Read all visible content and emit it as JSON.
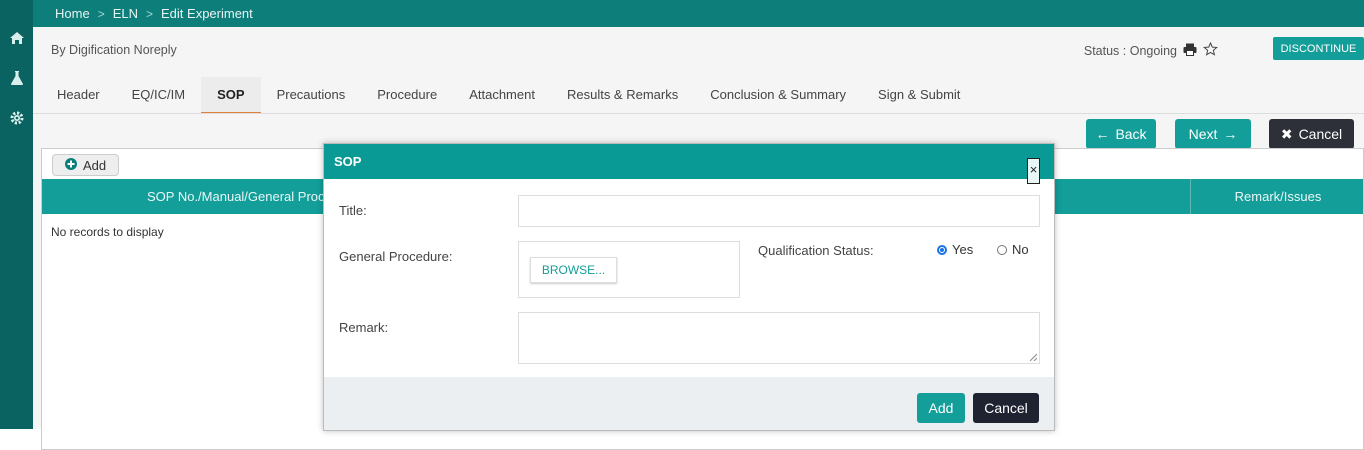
{
  "breadcrumb": [
    "Home",
    "ELN",
    "Edit Experiment"
  ],
  "user_name": "By Digification Noreply",
  "status_text": "Status : Ongoing",
  "discontinue_label": "DISCONTINUE",
  "tabs": [
    {
      "label": "Header"
    },
    {
      "label": "EQ/IC/IM"
    },
    {
      "label": "SOP",
      "active": true
    },
    {
      "label": "Precautions"
    },
    {
      "label": "Procedure"
    },
    {
      "label": "Attachment"
    },
    {
      "label": "Results & Remarks"
    },
    {
      "label": "Conclusion & Summary"
    },
    {
      "label": "Sign & Submit"
    }
  ],
  "nav_buttons": {
    "back": "Back",
    "next": "Next",
    "cancel": "Cancel"
  },
  "grid": {
    "add_label": "Add",
    "columns": [
      "SOP No./Manual/General Proc",
      "Remark/Issues"
    ],
    "empty_text": "No records to display"
  },
  "modal": {
    "title": "SOP",
    "close_glyph": "×",
    "title_label": "Title:",
    "general_procedure_label": "General Procedure:",
    "browse_label": "BROWSE...",
    "qualification_label": "Qualification Status:",
    "qualification_options": [
      "Yes",
      "No"
    ],
    "qualification_selected": "Yes",
    "remark_label": "Remark:",
    "add_label": "Add",
    "cancel_label": "Cancel"
  },
  "colors": {
    "sidebar": "#0a6360",
    "topbar": "#0d7e79",
    "accent": "#139e99",
    "dark_button": "#2d3038",
    "active_tab_underline": "#e0803a"
  },
  "icons": [
    "home-icon",
    "flask-icon",
    "gear-icon",
    "print-icon",
    "star-icon",
    "arrow-left-icon",
    "arrow-right-icon",
    "close-x-icon",
    "plus-circle-icon"
  ]
}
